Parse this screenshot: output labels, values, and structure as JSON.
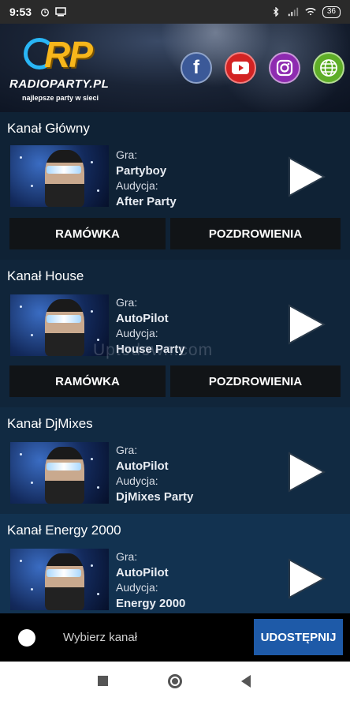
{
  "status_bar": {
    "time": "9:53",
    "battery": "36"
  },
  "header": {
    "logo_mark": "RP",
    "logo_name": "RADIOPARTY.PL",
    "tagline": "najlepsze party w sieci",
    "social": [
      {
        "icon": "facebook-icon"
      },
      {
        "icon": "youtube-icon"
      },
      {
        "icon": "instagram-icon"
      },
      {
        "icon": "globe-icon"
      }
    ]
  },
  "channels": [
    {
      "title": "Kanał Główny",
      "playing_label": "Gra:",
      "playing": "Partyboy",
      "show_label": "Audycja:",
      "show": "After Party",
      "buttons": {
        "schedule": "RAMÓWKA",
        "greetings": "POZDROWIENIA"
      }
    },
    {
      "title": "Kanał House",
      "playing_label": "Gra:",
      "playing": "AutoPilot",
      "show_label": "Audycja:",
      "show": "House Party",
      "buttons": {
        "schedule": "RAMÓWKA",
        "greetings": "POZDROWIENIA"
      }
    },
    {
      "title": "Kanał DjMixes",
      "playing_label": "Gra:",
      "playing": "AutoPilot",
      "show_label": "Audycja:",
      "show": "DjMixes Party"
    },
    {
      "title": "Kanał Energy 2000",
      "playing_label": "Gra:",
      "playing": "AutoPilot",
      "show_label": "Audycja:",
      "show": "Energy 2000"
    }
  ],
  "watermark": "Uptodown.com",
  "bottom_bar": {
    "select_channel": "Wybierz kanał",
    "share": "UDOSTĘPNIJ"
  },
  "colors": {
    "background": "#0d1b2a",
    "share_button": "#1e5aa8",
    "button_dark": "#111417",
    "logo_gold": "#f7b61b"
  }
}
